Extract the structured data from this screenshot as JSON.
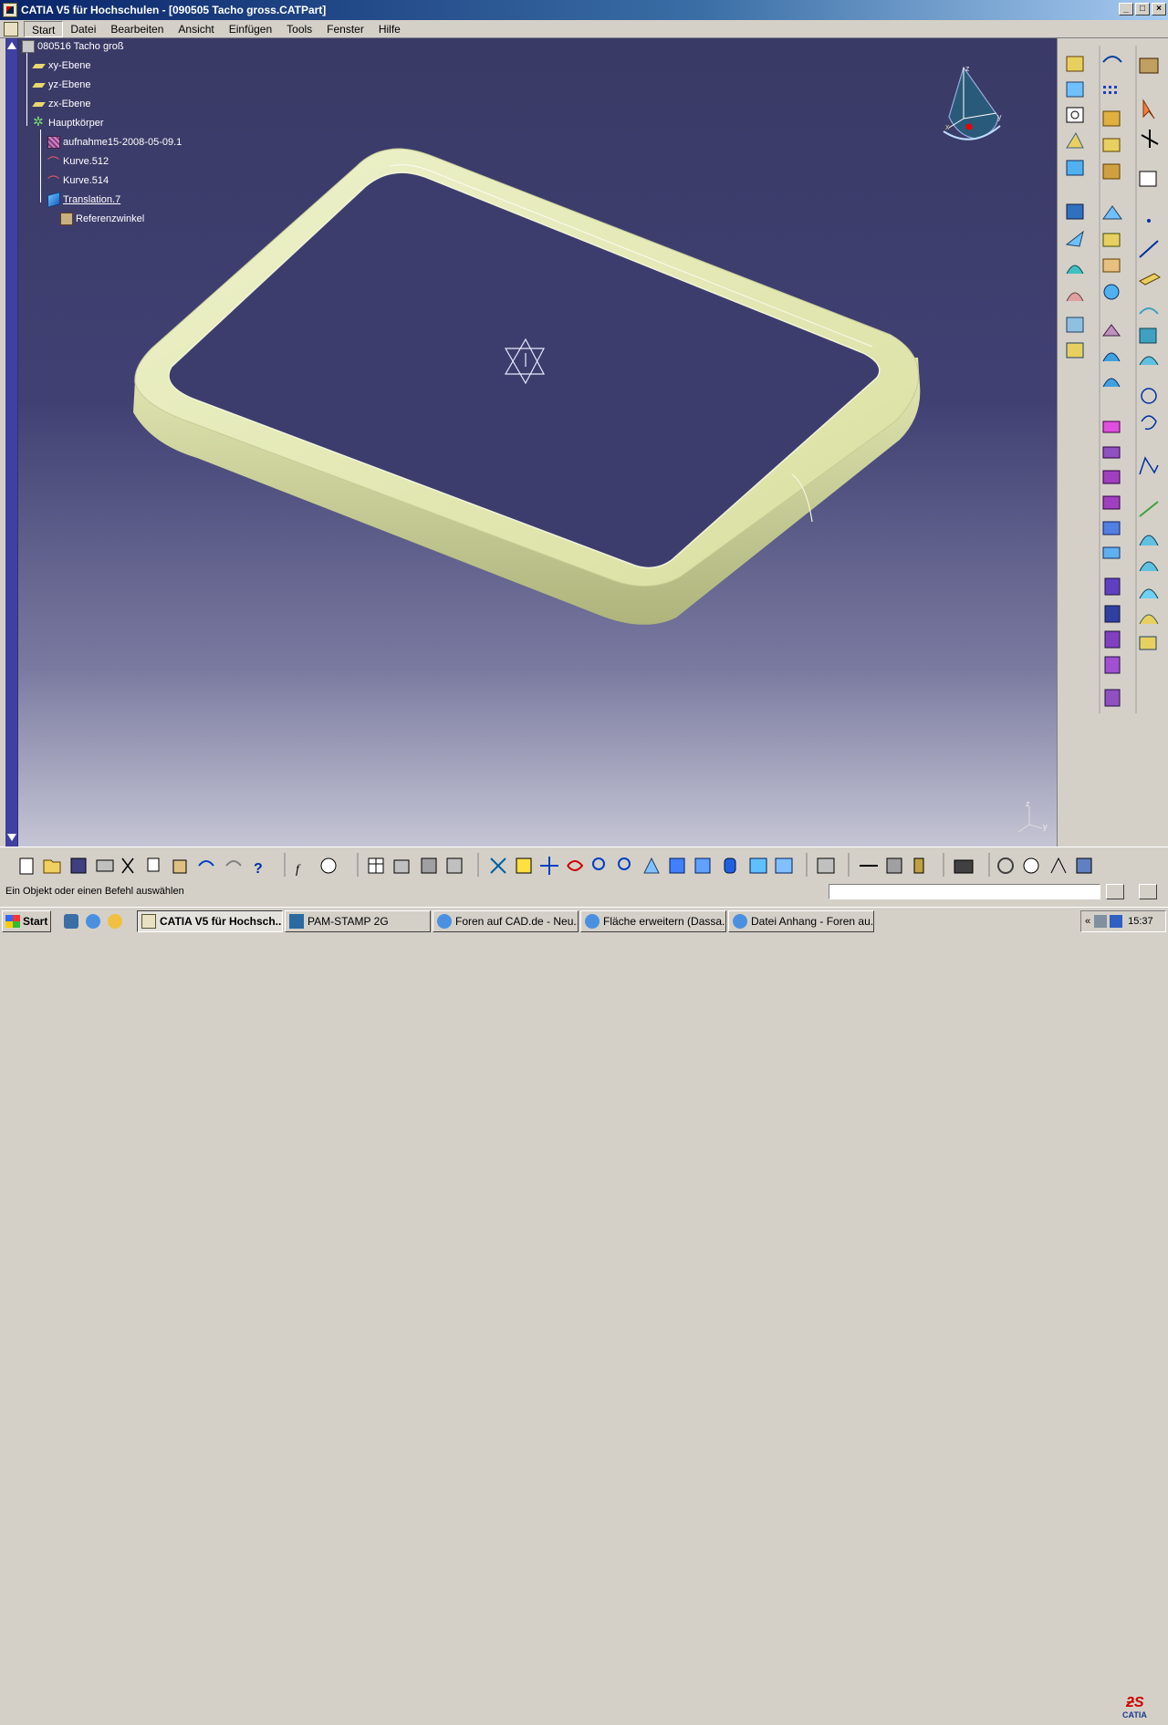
{
  "window": {
    "title": "CATIA V5 für Hochschulen - [090505 Tacho gross.CATPart]",
    "min_glyph": "_",
    "max_glyph": "□",
    "close_glyph": "×"
  },
  "menu": {
    "items": [
      "Start",
      "Datei",
      "Bearbeiten",
      "Ansicht",
      "Einfügen",
      "Tools",
      "Fenster",
      "Hilfe"
    ]
  },
  "tree": {
    "root": "080516 Tacho groß",
    "planes": [
      "xy-Ebene",
      "yz-Ebene",
      "zx-Ebene"
    ],
    "body": "Hauptkörper",
    "children": [
      "aufnahme15-2008-05-09.1",
      "Kurve.512",
      "Kurve.514",
      "Translation.7"
    ],
    "sub": "Referenzwinkel"
  },
  "compass": {
    "x": "x",
    "y": "y",
    "z": "z"
  },
  "status": {
    "message": "Ein Objekt oder einen Befehl auswählen",
    "command_value": ""
  },
  "catia_logo": "CATIA",
  "taskbar": {
    "start": "Start",
    "tasks": [
      "CATIA V5 für Hochsch...",
      "PAM-STAMP 2G",
      "Foren auf CAD.de - Neu...",
      "Fläche erweitern (Dassa...",
      "Datei Anhang - Foren au..."
    ],
    "tray_chevron": "«",
    "clock": "15:37"
  },
  "colors": {
    "part_face": "#e6ebc0",
    "part_shadow": "#b7bd86",
    "background_top": "#3a3a66",
    "background_bottom": "#c5c5d5"
  }
}
